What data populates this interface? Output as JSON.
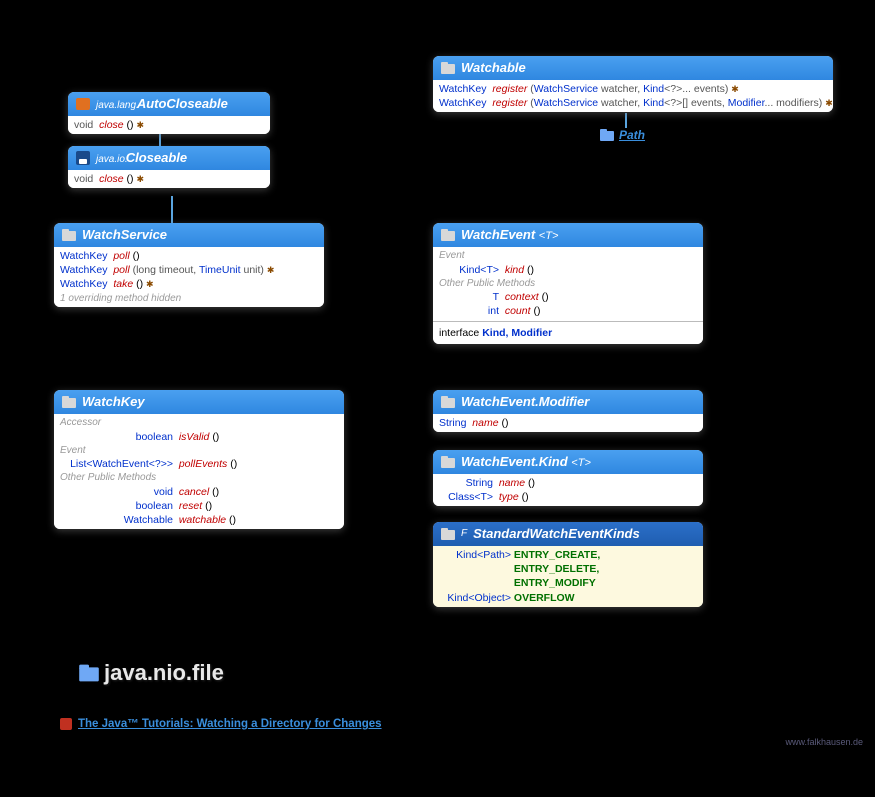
{
  "autocloseable": {
    "pkg": "java.lang.",
    "name": "AutoCloseable",
    "rows": [
      {
        "ret": "void",
        "method": "close",
        "params": "()",
        "ex": "✱"
      }
    ]
  },
  "closeable": {
    "pkg": "java.io.",
    "name": "Closeable",
    "rows": [
      {
        "ret": "void",
        "method": "close",
        "params": "()",
        "ex": "✱"
      }
    ]
  },
  "watchservice": {
    "name": "WatchService",
    "rows": [
      {
        "ret": "WatchKey",
        "method": "poll",
        "params": "()"
      },
      {
        "ret": "WatchKey",
        "method": "poll",
        "params": "(long timeout, TimeUnit unit)",
        "ex": "✱"
      },
      {
        "ret": "WatchKey",
        "method": "take",
        "params": "()",
        "ex": "✱"
      }
    ],
    "hidden": "1 overriding method hidden"
  },
  "watchkey": {
    "name": "WatchKey",
    "sections": [
      {
        "label": "Accessor",
        "rows": [
          {
            "ret": "boolean",
            "method": "isValid",
            "params": "()"
          }
        ]
      },
      {
        "label": "Event",
        "rows": [
          {
            "ret": "List<WatchEvent<?>>",
            "method": "pollEvents",
            "params": "()"
          }
        ]
      },
      {
        "label": "Other Public Methods",
        "rows": [
          {
            "ret": "void",
            "method": "cancel",
            "params": "()"
          },
          {
            "ret": "boolean",
            "method": "reset",
            "params": "()"
          },
          {
            "ret": "Watchable",
            "method": "watchable",
            "params": "()"
          }
        ]
      }
    ]
  },
  "watchable": {
    "name": "Watchable",
    "rows": [
      {
        "ret": "WatchKey",
        "method": "register",
        "params": "(WatchService watcher, Kind<?>... events)",
        "ex": "✱"
      },
      {
        "ret": "WatchKey",
        "method": "register",
        "params": "(WatchService watcher, Kind<?>[] events, Modifier... modifiers)",
        "ex": "✱"
      }
    ]
  },
  "path_link": "Path",
  "watchevent": {
    "name": "WatchEvent",
    "generic": "<T>",
    "sections": [
      {
        "label": "Event",
        "rows": [
          {
            "ret": "Kind<T>",
            "method": "kind",
            "params": "()"
          }
        ]
      },
      {
        "label": "Other Public Methods",
        "rows": [
          {
            "ret": "T",
            "method": "context",
            "params": "()"
          },
          {
            "ret": "int",
            "method": "count",
            "params": "()"
          }
        ]
      }
    ],
    "iface_prefix": "interface",
    "iface": "Kind, Modifier"
  },
  "modifier": {
    "name": "WatchEvent.Modifier",
    "rows": [
      {
        "ret": "String",
        "method": "name",
        "params": "()"
      }
    ]
  },
  "kind": {
    "name": "WatchEvent.Kind",
    "generic": "<T>",
    "rows": [
      {
        "ret": "String",
        "method": "name",
        "params": "()"
      },
      {
        "ret": "Class<T>",
        "method": "type",
        "params": "()"
      }
    ]
  },
  "standard": {
    "name": "StandardWatchEventKinds",
    "rows": [
      {
        "ret": "Kind<Path>",
        "vals": [
          "ENTRY_CREATE,",
          "ENTRY_DELETE,",
          "ENTRY_MODIFY"
        ]
      },
      {
        "ret": "Kind<Object>",
        "vals": [
          "OVERFLOW"
        ]
      }
    ]
  },
  "package_title": "java.nio.file",
  "tutorial": "The Java™ Tutorials: Watching a Directory for Changes",
  "watermark": "www.falkhausen.de"
}
